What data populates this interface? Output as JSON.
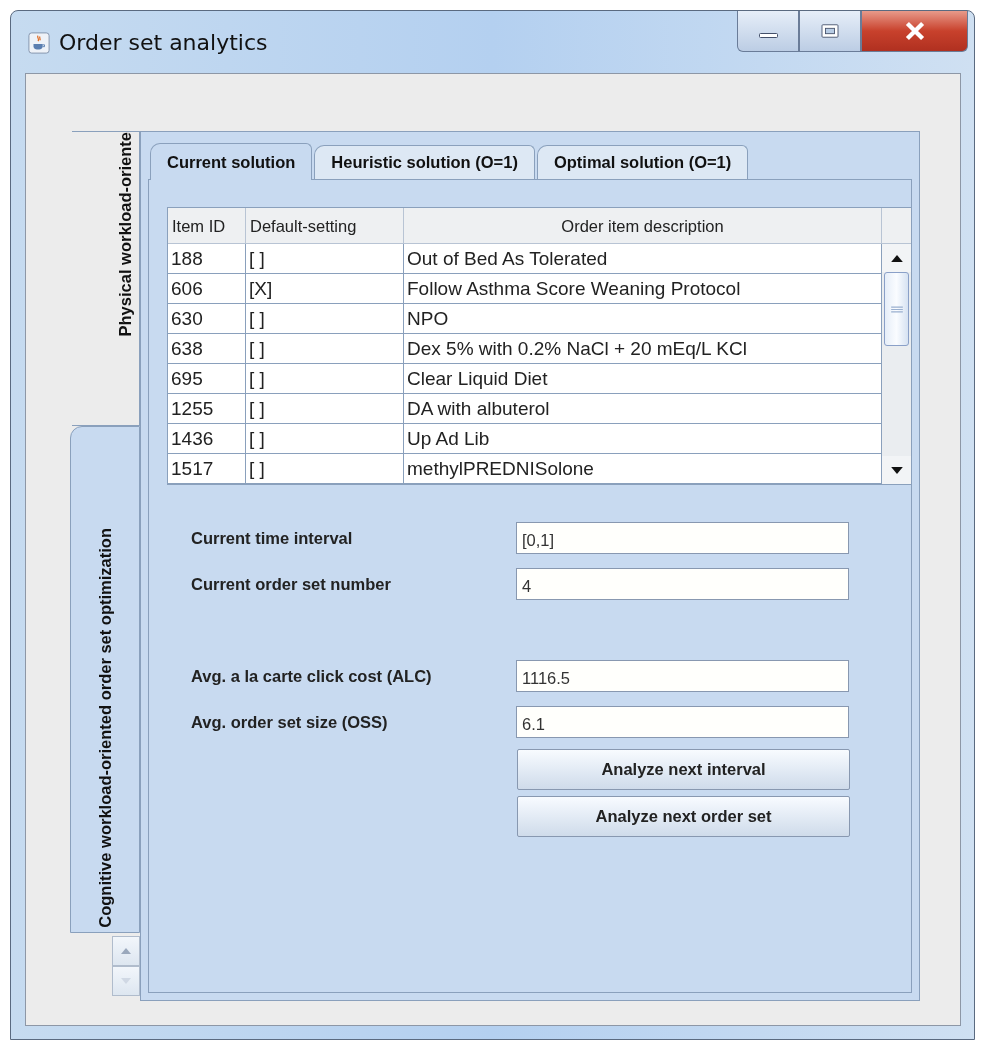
{
  "window": {
    "title": "Order set analytics"
  },
  "side_tabs": [
    {
      "label": "Physical workload-oriente",
      "selected": false
    },
    {
      "label": "Cognitive workload-oriented order set optimization",
      "selected": true
    }
  ],
  "tabs": [
    {
      "label": "Current solution",
      "selected": true
    },
    {
      "label": "Heuristic solution (O=1)",
      "selected": false
    },
    {
      "label": "Optimal solution (O=1)",
      "selected": false
    }
  ],
  "table": {
    "columns": [
      "Item ID",
      "Default-setting",
      "Order item description"
    ],
    "rows": [
      {
        "item_id": "188",
        "default_setting": "[  ]",
        "description": "Out of Bed As Tolerated"
      },
      {
        "item_id": "606",
        "default_setting": "[X]",
        "description": "Follow Asthma Score Weaning Protocol"
      },
      {
        "item_id": "630",
        "default_setting": "[  ]",
        "description": "NPO"
      },
      {
        "item_id": "638",
        "default_setting": "[  ]",
        "description": "Dex 5% with 0.2% NaCl + 20 mEq/L KCl"
      },
      {
        "item_id": "695",
        "default_setting": "[  ]",
        "description": "Clear Liquid Diet"
      },
      {
        "item_id": "1255",
        "default_setting": "[  ]",
        "description": "DA with albuterol"
      },
      {
        "item_id": "1436",
        "default_setting": "[  ]",
        "description": "Up Ad Lib"
      },
      {
        "item_id": "1517",
        "default_setting": "[  ]",
        "description": "methylPREDNISolone"
      }
    ]
  },
  "field_groups": [
    [
      {
        "label": "Current time interval",
        "value": "[0,1]"
      },
      {
        "label": "Current order set number",
        "value": "4"
      }
    ],
    [
      {
        "label": "Avg. a la carte click cost (ALC)",
        "value": "1116.5"
      },
      {
        "label": "Avg. order set size (OSS)",
        "value": "6.1"
      }
    ]
  ],
  "buttons": [
    "Analyze next interval",
    "Analyze next order set"
  ]
}
